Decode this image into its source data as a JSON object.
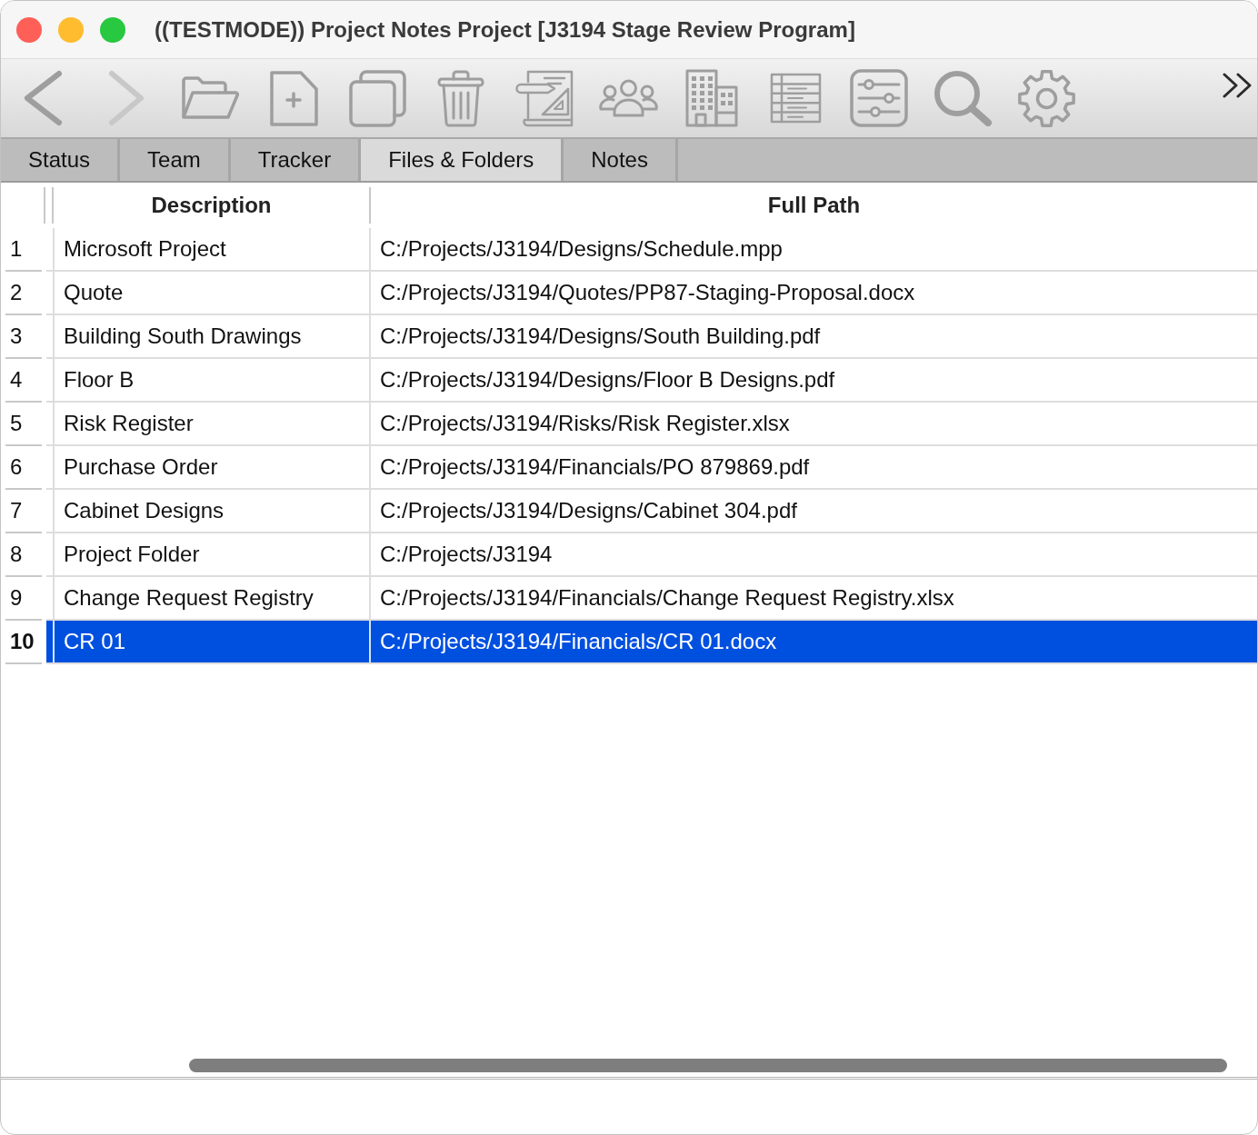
{
  "window": {
    "title": "((TESTMODE)) Project Notes Project [J3194 Stage Review Program]"
  },
  "toolbar": {
    "buttons": [
      {
        "kind": "back",
        "disabled": false
      },
      {
        "kind": "forward",
        "disabled": true
      },
      {
        "kind": "open",
        "disabled": false
      },
      {
        "kind": "new",
        "disabled": false
      },
      {
        "kind": "duplicate",
        "disabled": false
      },
      {
        "kind": "delete",
        "disabled": false
      },
      {
        "kind": "drafting",
        "disabled": false
      },
      {
        "kind": "team",
        "disabled": false
      },
      {
        "kind": "building",
        "disabled": false
      },
      {
        "kind": "list",
        "disabled": false
      },
      {
        "kind": "sliders",
        "disabled": false
      },
      {
        "kind": "search",
        "disabled": false
      },
      {
        "kind": "settings",
        "disabled": false
      }
    ]
  },
  "tabs": [
    {
      "label": "Status",
      "selected": false
    },
    {
      "label": "Team",
      "selected": false
    },
    {
      "label": "Tracker",
      "selected": false
    },
    {
      "label": "Files & Folders",
      "selected": true
    },
    {
      "label": "Notes",
      "selected": false
    }
  ],
  "table": {
    "columns": [
      "Description",
      "Full Path"
    ],
    "rows": [
      {
        "number": "1",
        "description": "Microsoft Project",
        "path": "C:/Projects/J3194/Designs/Schedule.mpp",
        "selected": false
      },
      {
        "number": "2",
        "description": "Quote",
        "path": "C:/Projects/J3194/Quotes/PP87-Staging-Proposal.docx",
        "selected": false
      },
      {
        "number": "3",
        "description": "Building South Drawings",
        "path": "C:/Projects/J3194/Designs/South Building.pdf",
        "selected": false
      },
      {
        "number": "4",
        "description": "Floor B",
        "path": "C:/Projects/J3194/Designs/Floor B Designs.pdf",
        "selected": false
      },
      {
        "number": "5",
        "description": "Risk Register",
        "path": "C:/Projects/J3194/Risks/Risk Register.xlsx",
        "selected": false
      },
      {
        "number": "6",
        "description": "Purchase Order",
        "path": "C:/Projects/J3194/Financials/PO 879869.pdf",
        "selected": false
      },
      {
        "number": "7",
        "description": "Cabinet Designs",
        "path": "C:/Projects/J3194/Designs/Cabinet 304.pdf",
        "selected": false
      },
      {
        "number": "8",
        "description": "Project Folder",
        "path": "C:/Projects/J3194",
        "selected": false
      },
      {
        "number": "9",
        "description": "Change Request Registry",
        "path": "C:/Projects/J3194/Financials/Change Request Registry.xlsx",
        "selected": false
      },
      {
        "number": "10",
        "description": "CR 01",
        "path": "C:/Projects/J3194/Financials/CR 01.docx",
        "selected": true
      }
    ]
  }
}
